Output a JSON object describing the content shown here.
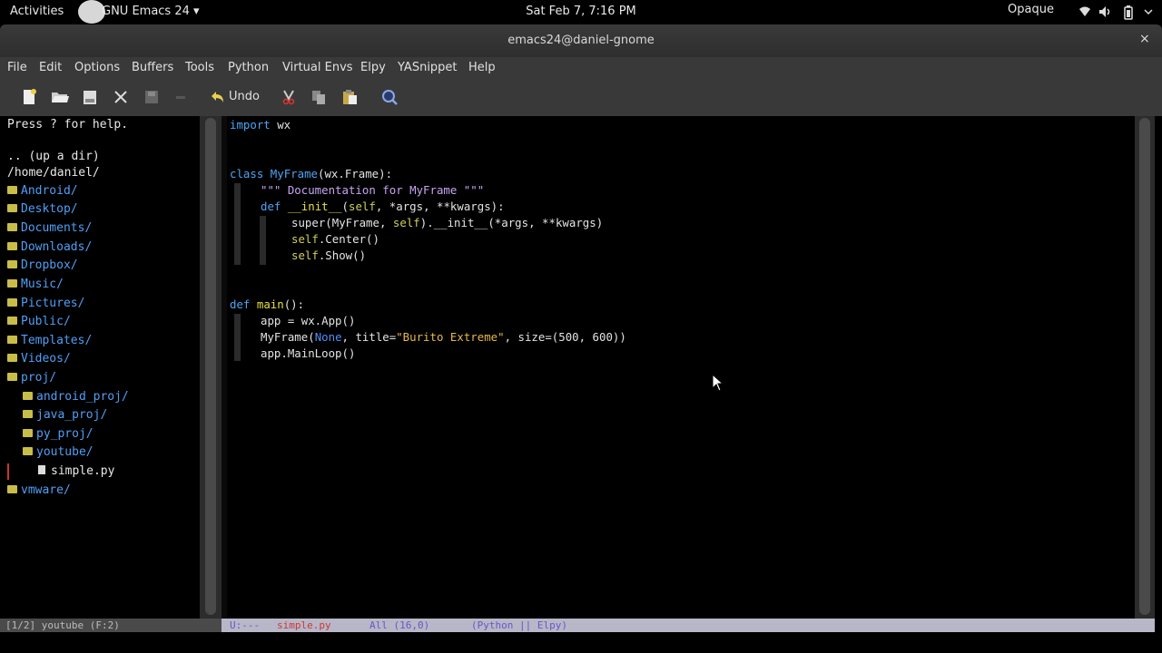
{
  "topbar": {
    "activities": "Activities",
    "app_menu": "GNU Emacs 24 ▾",
    "clock": "Sat Feb  7,  7:16 PM",
    "right_label": "Opaque"
  },
  "window": {
    "title": "emacs24@daniel-gnome",
    "close": "×"
  },
  "menubar": {
    "items": [
      "File",
      "Edit",
      "Options",
      "Buffers",
      "Tools",
      "Python",
      "Virtual Envs",
      "Elpy",
      "YASnippet",
      "Help"
    ]
  },
  "toolbar": {
    "undo_label": "Undo"
  },
  "dired": {
    "help": "Press ? for help.",
    "up": ".. (up a dir)",
    "cwd": "/home/daniel/",
    "entries": [
      {
        "name": "Android/",
        "indent": 0,
        "kind": "dir"
      },
      {
        "name": "Desktop/",
        "indent": 0,
        "kind": "dir"
      },
      {
        "name": "Documents/",
        "indent": 0,
        "kind": "dir"
      },
      {
        "name": "Downloads/",
        "indent": 0,
        "kind": "dir"
      },
      {
        "name": "Dropbox/",
        "indent": 0,
        "kind": "dir"
      },
      {
        "name": "Music/",
        "indent": 0,
        "kind": "dir"
      },
      {
        "name": "Pictures/",
        "indent": 0,
        "kind": "dir"
      },
      {
        "name": "Public/",
        "indent": 0,
        "kind": "dir"
      },
      {
        "name": "Templates/",
        "indent": 0,
        "kind": "dir"
      },
      {
        "name": "Videos/",
        "indent": 0,
        "kind": "dir"
      },
      {
        "name": "proj/",
        "indent": 0,
        "kind": "dir"
      },
      {
        "name": "android_proj/",
        "indent": 1,
        "kind": "dir"
      },
      {
        "name": "java_proj/",
        "indent": 1,
        "kind": "dir"
      },
      {
        "name": "py_proj/",
        "indent": 1,
        "kind": "dir"
      },
      {
        "name": "youtube/",
        "indent": 1,
        "kind": "dir"
      },
      {
        "name": "simple.py",
        "indent": 2,
        "kind": "file"
      },
      {
        "name": "vmware/",
        "indent": 0,
        "kind": "dir"
      }
    ]
  },
  "code": {
    "l1_import": "import",
    "l1_mod": " wx",
    "l4_class": "class",
    "l4_name": "MyFrame",
    "l4_rest": "(wx.Frame):",
    "l5_doc": "\"\"\" Documentation for MyFrame \"\"\"",
    "l6_def": "def",
    "l6_name": "__init__",
    "l6_open": "(",
    "l6_self": "self",
    "l6_rest": ", *args, **kwargs):",
    "l7_a": "super(MyFrame, ",
    "l7_self": "self",
    "l7_b": ").__init__(*args, **kwargs)",
    "l8_self": "self",
    "l8_rest": ".Center()",
    "l9_self": "self",
    "l9_rest": ".Show()",
    "l12_def": "def",
    "l12_name": "main",
    "l12_rest": "():",
    "l13": "app = wx.App()",
    "l14_a": "MyFrame(",
    "l14_none": "None",
    "l14_b": ", title=",
    "l14_str": "\"Burito Extreme\"",
    "l14_c": ", size=(500, 600))",
    "l15": "app.MainLoop()"
  },
  "modeline": {
    "left": "[1/2] youtube (F:2)",
    "status": "U:---",
    "buffer": "simple.py",
    "position": "All (16,0)",
    "modes": "(Python || Elpy)"
  }
}
